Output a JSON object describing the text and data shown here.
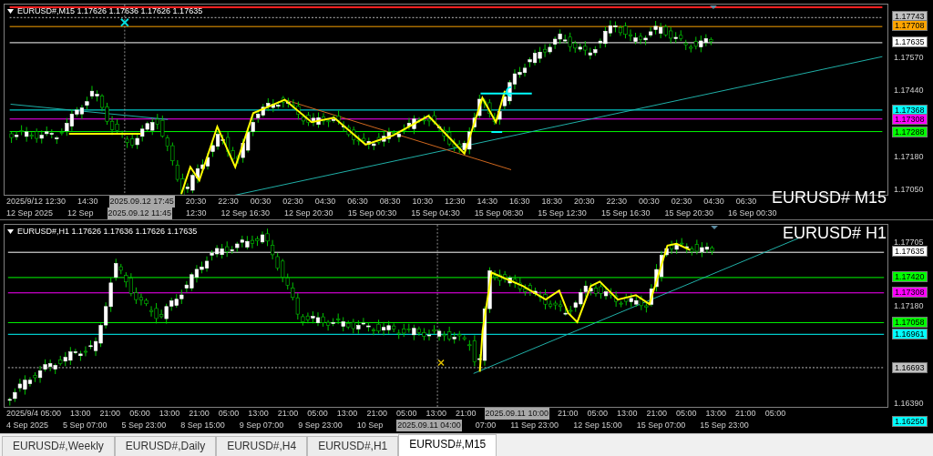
{
  "panels": [
    {
      "header": "EURUSD#,M15  1.17626 1.17636 1.17626 1.17635",
      "title": "EURUSD# M15",
      "price_labels": [
        {
          "text": "1.17743",
          "kind": "tag",
          "color": "#c0c0c0"
        },
        {
          "text": "1.17708",
          "kind": "tag",
          "color": "#ffa500"
        },
        {
          "text": "1.17635",
          "kind": "tag",
          "color": "#ffffff"
        },
        {
          "text": "1.17570",
          "kind": "tick"
        },
        {
          "text": "1.17440",
          "kind": "tick"
        },
        {
          "text": "1.17368",
          "kind": "tag",
          "color": "#00ffff"
        },
        {
          "text": "1.17308",
          "kind": "tag",
          "color": "#ff00ff"
        },
        {
          "text": "1.17288",
          "kind": "tag",
          "color": "#00ff00"
        },
        {
          "text": "1.17180",
          "kind": "tick"
        },
        {
          "text": "1.17050",
          "kind": "tick"
        }
      ],
      "time_upper": [
        {
          "text": "2025/9/12 12:30",
          "highlighted": false
        },
        {
          "text": "14:30",
          "highlighted": false
        },
        {
          "text": "2025.09.12 17:45",
          "highlighted": true
        },
        {
          "text": "20:30",
          "highlighted": false
        },
        {
          "text": "22:30",
          "highlighted": false
        },
        {
          "text": "00:30",
          "highlighted": false
        },
        {
          "text": "02:30",
          "highlighted": false
        },
        {
          "text": "04:30",
          "highlighted": false
        },
        {
          "text": "06:30",
          "highlighted": false
        },
        {
          "text": "08:30",
          "highlighted": false
        },
        {
          "text": "10:30",
          "highlighted": false
        },
        {
          "text": "12:30",
          "highlighted": false
        },
        {
          "text": "14:30",
          "highlighted": false
        },
        {
          "text": "16:30",
          "highlighted": false
        },
        {
          "text": "18:30",
          "highlighted": false
        },
        {
          "text": "20:30",
          "highlighted": false
        },
        {
          "text": "22:30",
          "highlighted": false
        },
        {
          "text": "00:30",
          "highlighted": false
        },
        {
          "text": "02:30",
          "highlighted": false
        },
        {
          "text": "04:30",
          "highlighted": false
        },
        {
          "text": "06:30",
          "highlighted": false
        }
      ],
      "time_lower": [
        {
          "text": "12 Sep 2025",
          "highlighted": false
        },
        {
          "text": "12 Sep",
          "highlighted": false
        },
        {
          "text": "2025.09.12 11:45",
          "highlighted": true
        },
        {
          "text": "12:30",
          "highlighted": false
        },
        {
          "text": "12 Sep 16:30",
          "highlighted": false
        },
        {
          "text": "12 Sep 20:30",
          "highlighted": false
        },
        {
          "text": "15 Sep 00:30",
          "highlighted": false
        },
        {
          "text": "15 Sep 04:30",
          "highlighted": false
        },
        {
          "text": "15 Sep 08:30",
          "highlighted": false
        },
        {
          "text": "15 Sep 12:30",
          "highlighted": false
        },
        {
          "text": "15 Sep 16:30",
          "highlighted": false
        },
        {
          "text": "15 Sep 20:30",
          "highlighted": false
        },
        {
          "text": "16 Sep 00:30",
          "highlighted": false
        }
      ]
    },
    {
      "header": "EURUSD#,H1  1.17626 1.17636 1.17626 1.17635",
      "title": "EURUSD# H1",
      "price_labels": [
        {
          "text": "1.17705",
          "kind": "tick"
        },
        {
          "text": "1.17635",
          "kind": "tag",
          "color": "#ffffff"
        },
        {
          "text": "1.17420",
          "kind": "tag",
          "color": "#00ff00"
        },
        {
          "text": "1.17308",
          "kind": "tag",
          "color": "#ff00ff"
        },
        {
          "text": "1.17180",
          "kind": "tick"
        },
        {
          "text": "1.17058",
          "kind": "tag",
          "color": "#00ff00"
        },
        {
          "text": "1.16961",
          "kind": "tag",
          "color": "#00ffff"
        },
        {
          "text": "1.16693",
          "kind": "tag",
          "color": "#c0c0c0"
        },
        {
          "text": "1.16390",
          "kind": "tick"
        },
        {
          "text": "1.16250",
          "kind": "tag",
          "color": "#00ffff"
        }
      ],
      "time_upper": [
        {
          "text": "2025/9/4 05:00",
          "highlighted": false
        },
        {
          "text": "13:00",
          "highlighted": false
        },
        {
          "text": "21:00",
          "highlighted": false
        },
        {
          "text": "05:00",
          "highlighted": false
        },
        {
          "text": "13:00",
          "highlighted": false
        },
        {
          "text": "21:00",
          "highlighted": false
        },
        {
          "text": "05:00",
          "highlighted": false
        },
        {
          "text": "13:00",
          "highlighted": false
        },
        {
          "text": "21:00",
          "highlighted": false
        },
        {
          "text": "05:00",
          "highlighted": false
        },
        {
          "text": "13:00",
          "highlighted": false
        },
        {
          "text": "21:00",
          "highlighted": false
        },
        {
          "text": "05:00",
          "highlighted": false
        },
        {
          "text": "13:00",
          "highlighted": false
        },
        {
          "text": "21:00",
          "highlighted": false
        },
        {
          "text": "2025.09.11 10:00",
          "highlighted": true
        },
        {
          "text": "21:00",
          "highlighted": false
        },
        {
          "text": "05:00",
          "highlighted": false
        },
        {
          "text": "13:00",
          "highlighted": false
        },
        {
          "text": "21:00",
          "highlighted": false
        },
        {
          "text": "05:00",
          "highlighted": false
        },
        {
          "text": "13:00",
          "highlighted": false
        },
        {
          "text": "21:00",
          "highlighted": false
        },
        {
          "text": "05:00",
          "highlighted": false
        }
      ],
      "time_lower": [
        {
          "text": "4 Sep 2025",
          "highlighted": false
        },
        {
          "text": "5 Sep 07:00",
          "highlighted": false
        },
        {
          "text": "5 Sep 23:00",
          "highlighted": false
        },
        {
          "text": "8 Sep 15:00",
          "highlighted": false
        },
        {
          "text": "9 Sep 07:00",
          "highlighted": false
        },
        {
          "text": "9 Sep 23:00",
          "highlighted": false
        },
        {
          "text": "10 Sep",
          "highlighted": false
        },
        {
          "text": "2025.09.11 04:00",
          "highlighted": true
        },
        {
          "text": "07:00",
          "highlighted": false
        },
        {
          "text": "11 Sep 23:00",
          "highlighted": false
        },
        {
          "text": "12 Sep 15:00",
          "highlighted": false
        },
        {
          "text": "15 Sep 07:00",
          "highlighted": false
        },
        {
          "text": "15 Sep 23:00",
          "highlighted": false
        }
      ]
    }
  ],
  "tabs": [
    {
      "label": "EURUSD#,Weekly",
      "selected": false
    },
    {
      "label": "EURUSD#,Daily",
      "selected": false
    },
    {
      "label": "EURUSD#,H4",
      "selected": false
    },
    {
      "label": "EURUSD#,H1",
      "selected": false
    },
    {
      "label": "EURUSD#,M15",
      "selected": true
    }
  ]
}
